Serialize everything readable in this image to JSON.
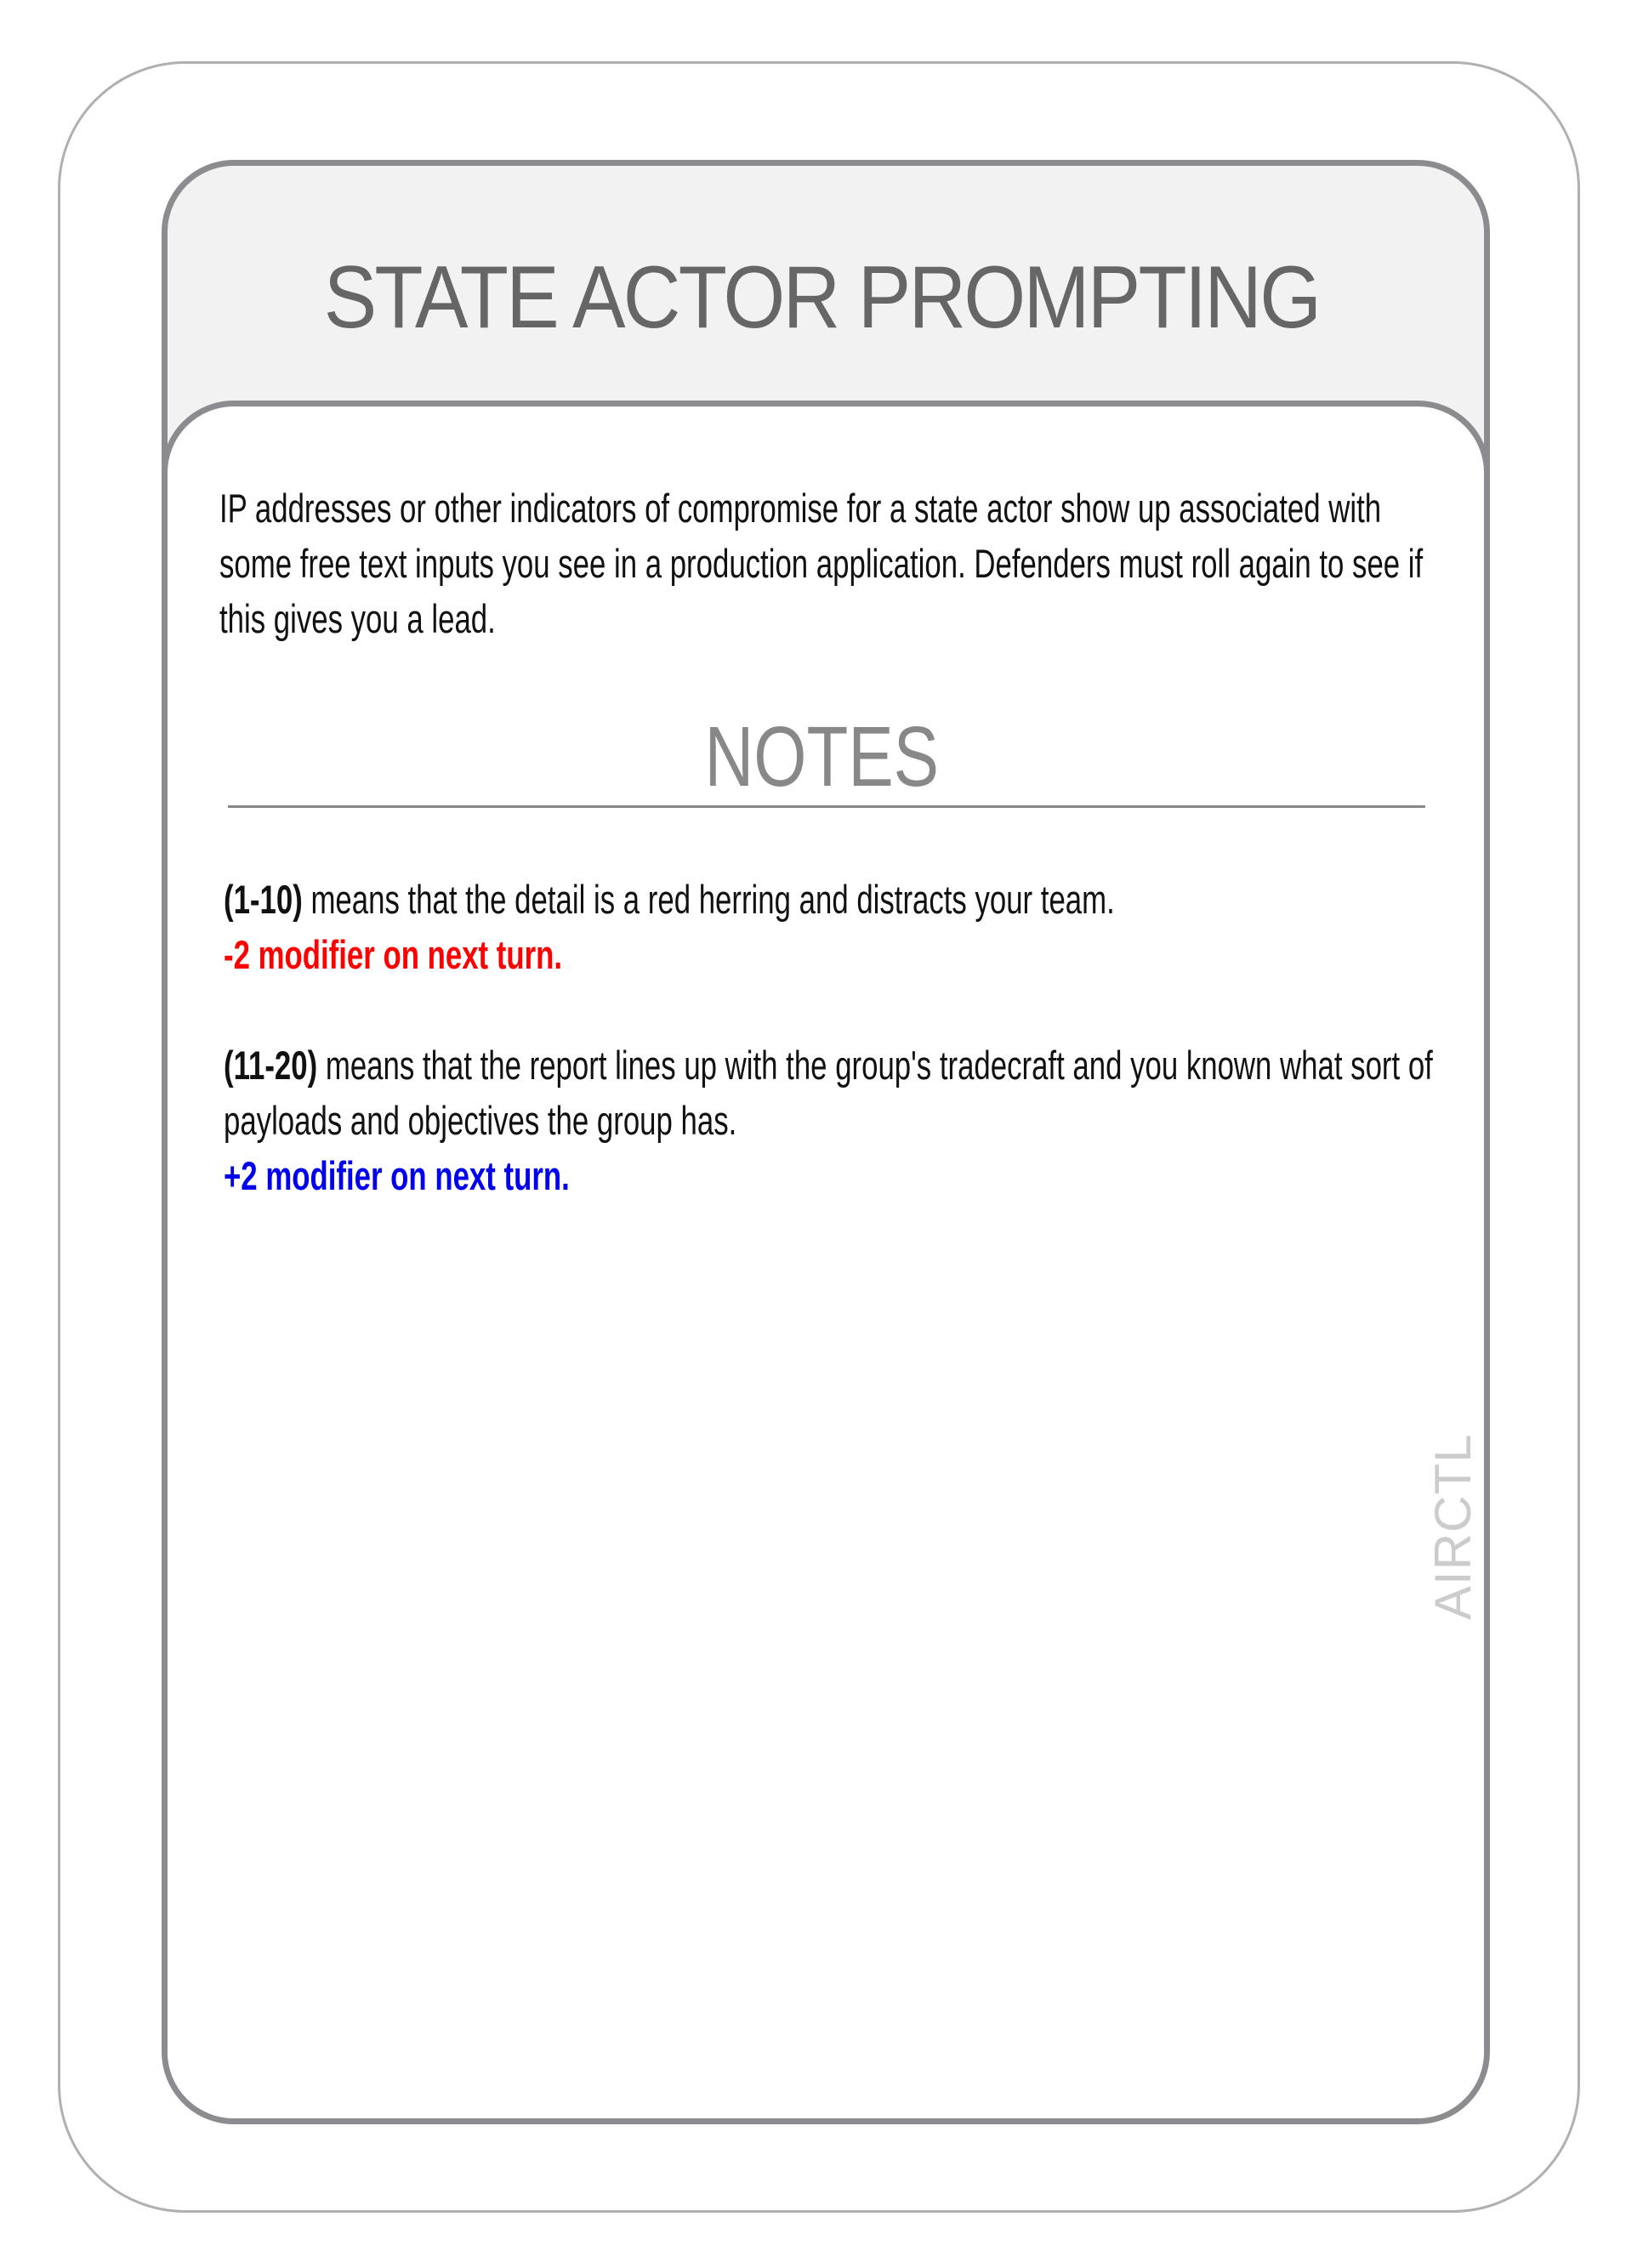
{
  "card": {
    "title": "STATE ACTOR PROMPTING",
    "description": "IP addresses or other indicators of compromise for a state actor show up associated with some free text inputs you see in a production application. Defenders must roll again to see if this gives you a lead.",
    "notes_heading": "NOTES",
    "outcomes": [
      {
        "range": "(1-10)",
        "text": " means that the detail is a red herring and distracts your team.",
        "modifier": "-2 modifier on next turn.",
        "color": "#ff0000"
      },
      {
        "range": "(11-20)",
        "text": " means that the report lines up with the group's tradecraft and you known what sort of payloads and objectives the group has.",
        "modifier": "+2 modifier on next turn.",
        "color": "#0000ee"
      }
    ],
    "brand": "AIRCTL"
  }
}
